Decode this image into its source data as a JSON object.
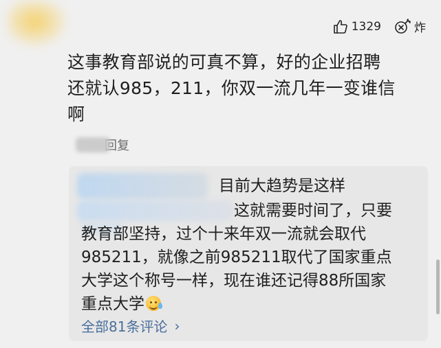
{
  "actions": {
    "like_count": "1329",
    "bomb_label": "炸"
  },
  "comment": {
    "text_lines": [
      "这事教育部说的可真不算，好的企业招聘",
      "还就认985，211，你双一流几年一变谁信",
      "啊"
    ]
  },
  "reply_link": {
    "label": "回复"
  },
  "reply_card": {
    "line1": "目前大趋势是这样",
    "line2": "这就需要时间了，只要",
    "body_lines": [
      "教育部坚持，过个十来年双一流就会取代",
      "985211，就像之前985211取代了国家重点",
      "大学这个称号一样，现在谁还记得88所国家",
      "重点大学"
    ],
    "emoji": "crying-laughing-emoji",
    "view_all": "全部81条评论",
    "view_all_chevron": "›"
  },
  "colors": {
    "background": "#f0f0f0",
    "card": "#e7e7e7",
    "link": "#4a6f9c",
    "text": "#1f1f1f",
    "muted": "#6b6b6b"
  }
}
